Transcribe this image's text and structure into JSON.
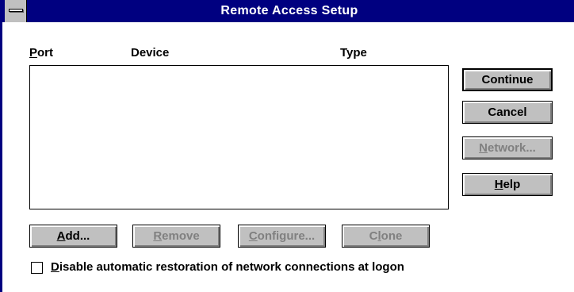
{
  "window": {
    "title": "Remote Access Setup"
  },
  "columns": {
    "port_label_first": "P",
    "port_label_rest": "ort",
    "device_label": "Device",
    "type_label": "Type"
  },
  "buttons": {
    "continue": "Continue",
    "cancel": "Cancel",
    "network_first": "N",
    "network_rest": "etwork...",
    "help_first": "H",
    "help_rest": "elp",
    "add_first": "A",
    "add_rest": "dd...",
    "remove_first": "R",
    "remove_rest": "emove",
    "configure_first": "C",
    "configure_rest": "onfigure...",
    "clone_first": "C",
    "clone_mid": "l",
    "clone_rest": "one"
  },
  "checkbox": {
    "label_first": "D",
    "label_rest": "isable automatic restoration of network connections at logon",
    "checked": false
  },
  "colors": {
    "titlebar": "#000080",
    "button_face": "#c0c0c0",
    "disabled_text": "#808080"
  }
}
